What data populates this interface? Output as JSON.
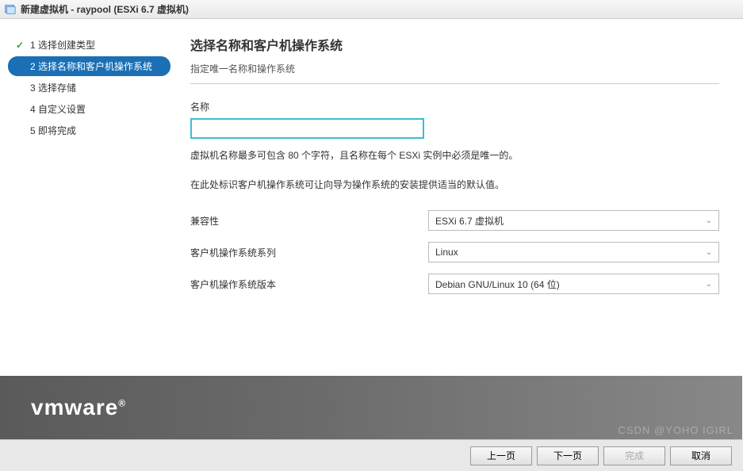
{
  "window": {
    "title": "新建虚拟机 - raypool (ESXi 6.7 虚拟机)"
  },
  "steps": {
    "s1": "1 选择创建类型",
    "s2": "2 选择名称和客户机操作系统",
    "s3": "3 选择存储",
    "s4": "4 自定义设置",
    "s5": "5 即将完成"
  },
  "page": {
    "heading": "选择名称和客户机操作系统",
    "subtitle": "指定唯一名称和操作系统",
    "name_label": "名称",
    "name_value": "",
    "hint1": "虚拟机名称最多可包含 80 个字符，且名称在每个 ESXi 实例中必须是唯一的。",
    "hint2": "在此处标识客户机操作系统可让向导为操作系统的安装提供适当的默认值。"
  },
  "form": {
    "compat_label": "兼容性",
    "compat_value": "ESXi 6.7 虚拟机",
    "osfam_label": "客户机操作系统系列",
    "osfam_value": "Linux",
    "osver_label": "客户机操作系统版本",
    "osver_value": "Debian GNU/Linux 10 (64 位)"
  },
  "logo": "vmware",
  "buttons": {
    "back": "上一页",
    "next": "下一页",
    "finish": "完成",
    "cancel": "取消"
  },
  "watermark": "CSDN @YOHO IGIRL"
}
